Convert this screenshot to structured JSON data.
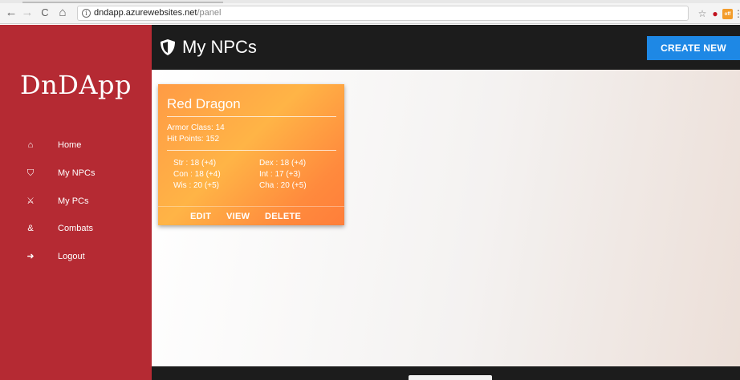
{
  "browser": {
    "nav": {
      "back": "←",
      "forward": "→",
      "reload": "C",
      "home": "⌂"
    },
    "url": {
      "info": "i",
      "host": "dndapp.azurewebsites.net",
      "path": "/panel"
    },
    "extensions": {
      "star": "☆",
      "ublock": "●",
      "amazon": "off",
      "menu": "⋮"
    }
  },
  "sidebar": {
    "logo": "DnDApp",
    "items": [
      {
        "icon": "home-icon",
        "glyph": "⌂",
        "label": "Home"
      },
      {
        "icon": "shield-icon",
        "glyph": "⛉",
        "label": "My NPCs"
      },
      {
        "icon": "sword-icon",
        "glyph": "⚔",
        "label": "My PCs"
      },
      {
        "icon": "ampersand-icon",
        "glyph": "&",
        "label": "Combats"
      },
      {
        "icon": "logout-icon",
        "glyph": "➜",
        "label": "Logout"
      }
    ]
  },
  "header": {
    "title": "My NPCs",
    "create_label": "CREATE NEW"
  },
  "npc_card": {
    "name": "Red Dragon",
    "armor_class": "Armor Class: 14",
    "hit_points": "Hit Points: 152",
    "stats": {
      "str": "Str : 18 (+4)",
      "dex": "Dex : 18 (+4)",
      "con": "Con : 18 (+4)",
      "int": "Int : 17 (+3)",
      "wis": "Wis : 20 (+5)",
      "cha": "Cha : 20 (+5)"
    },
    "actions": {
      "edit": "EDIT",
      "view": "VIEW",
      "delete": "DELETE"
    }
  },
  "colors": {
    "sidebar": "#b52a33",
    "header": "#1c1c1c",
    "accent": "#1e88e5",
    "card_from": "#ffb446",
    "card_to": "#ff7e3a"
  }
}
